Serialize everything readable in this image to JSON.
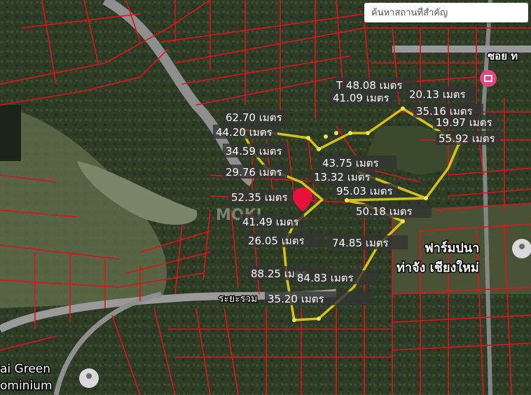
{
  "search": {
    "placeholder": "ค้นหาสถานที่สำคัญ"
  },
  "colors": {
    "parcel_border": "#e0121b",
    "plot_outline": "#d4c21a",
    "vertex": "#f1e25a",
    "label_bg": "#333333",
    "label_text": "#ffffff",
    "road": "#8f8f8f",
    "marker": "#e5123c"
  },
  "icons": {
    "red_pin": "map-pin-icon",
    "hospital": "hospital-icon",
    "place_pin": "location-pin-icon"
  },
  "map_labels": {
    "road_top_right": "ซอย ท",
    "farm_line1": "ฟาร์มปนา",
    "farm_line2": "ท่าจัง เชียงใหม่",
    "road_left": "ระยะรวม",
    "bottom_left_line1": "ai Green",
    "bottom_left_line2": "ominium",
    "watermark": "MOKI"
  },
  "measurements": [
    "T 48.08 เมตร",
    "41.09 เมตร",
    "20.13 เมตร",
    "35.16 เมตร",
    "19.97 เมตร",
    "55.92 เมตร",
    "62.70 เมตร",
    "44.20 เมตร",
    "34.59 เมตร",
    "29.76 เมตร",
    "43.75 เมตร",
    "13.32 เมตร",
    "95.03 เมตร",
    "52.35 เมตร",
    "50.18 เมตร",
    "41.49 เมตร",
    "26.05 เมตร",
    "74.85 เมตร",
    "88.25 เมตร",
    "84.83 เมตร",
    "35.20 เมตร"
  ]
}
